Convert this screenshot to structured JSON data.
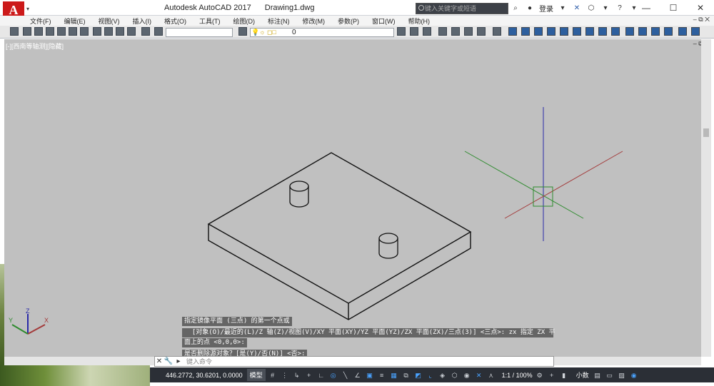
{
  "app": {
    "title": "Autodesk AutoCAD 2017",
    "document": "Drawing1.dwg",
    "logo_letter": "A",
    "search_placeholder": "键入关键字或短语",
    "sign_in": "登录"
  },
  "menu": [
    "文件(F)",
    "编辑(E)",
    "视图(V)",
    "插入(I)",
    "格式(O)",
    "工具(T)",
    "绘图(D)",
    "标注(N)",
    "修改(M)",
    "参数(P)",
    "窗口(W)",
    "帮助(H)"
  ],
  "toolbar": {
    "layer_value": "0"
  },
  "viewport": {
    "label": "[-][西南等轴测][隐藏]"
  },
  "command": {
    "history": [
      "指定镜像平面 (三点) 的第一个点或",
      "  [对象(O)/最近的(L)/Z 轴(Z)/视图(V)/XY 平面(XY)/YZ 平面(YZ)/ZX 平面(ZX)/三点(3)] <三点>: zx 指定 ZX 平",
      "面上的点 <0,0,0>:",
      "是否删除源对象？[是(Y)/否(N)] <否>:"
    ],
    "input_placeholder": "键入命令"
  },
  "status": {
    "coordinates": "446.2772, 30.6201, 0.0000",
    "model": "模型",
    "scale": "1:1 / 100%",
    "units": "小数"
  },
  "ucs_labels": {
    "x": "X",
    "y": "Y",
    "z": "Z"
  },
  "colors": {
    "canvas": "#c0c0c0",
    "x_axis": "#a33a3a",
    "y_axis": "#2e8b2e",
    "z_axis": "#2a2aa8",
    "statusbar": "#2b2f36"
  }
}
